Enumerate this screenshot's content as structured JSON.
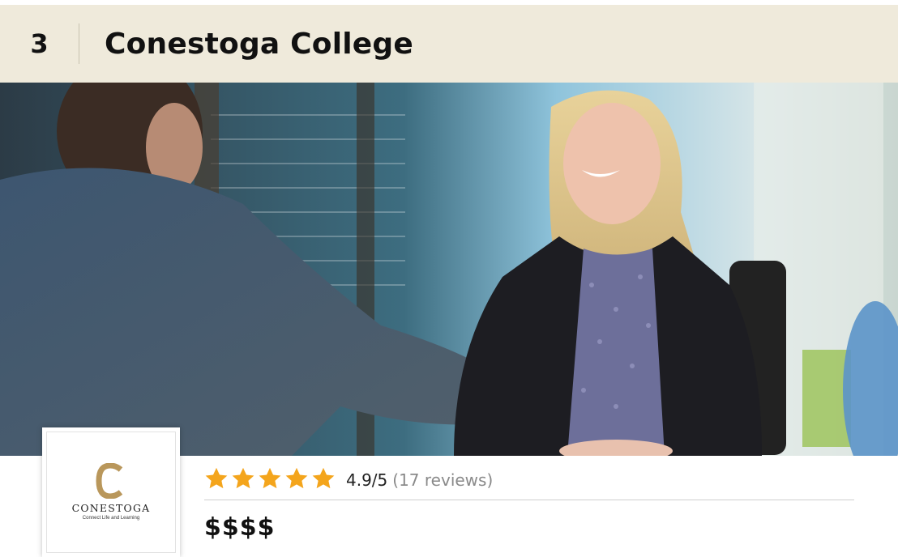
{
  "header": {
    "rank": "3",
    "title": "Conestoga College"
  },
  "hero": {
    "image": "photo-two-people-shaking-hands-interview"
  },
  "logo": {
    "letter": "C",
    "name": "CONESTOGA",
    "tagline": "Connect Life and Learning",
    "accent": "#b9975b"
  },
  "rating": {
    "stars": 5,
    "star_color": "#f4a51c",
    "score": "4.9/5",
    "reviews": "(17 reviews)"
  },
  "price": {
    "label": "$$$$"
  }
}
